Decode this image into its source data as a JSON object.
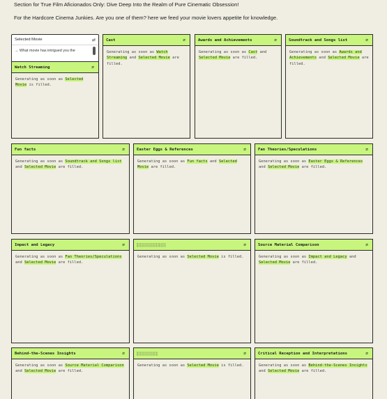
{
  "header": {
    "line1": "Section for True Film Aficionados Only: Dive Deep Into the Realm of Pure Cinematic Obsession!",
    "line2": "For the Hardcore Cinema Junkies. Are you one of them? here we feed your movie lovers appetite for knowledge."
  },
  "selected_movie": {
    "label": "Selected Movie",
    "prompt": "→ What movie has intrigued you the"
  },
  "common": {
    "prefix": "Generating as soon as ",
    "and": " and ",
    "is_filled": " is filled.",
    "are_filled": " are filled.",
    "selected_movie": "Selected Movie",
    "icon": "⇄"
  },
  "cards": {
    "watch_streaming": {
      "title": "Watch Streaming"
    },
    "cast": {
      "title": "Cast",
      "dep": "Watch Streaming"
    },
    "awards": {
      "title": "Awards and Achievements",
      "dep": "Cast"
    },
    "soundtrack": {
      "title": "Soundtrack and Songs list",
      "dep": "Awards and Achievements"
    },
    "fun_facts": {
      "title": "Fun facts",
      "dep": "Soundtrack and Songs list"
    },
    "easter_eggs": {
      "title": "Easter Eggs & References",
      "dep": "Fun facts"
    },
    "fan_theories": {
      "title": "Fan Theories/Speculations",
      "dep": "Easter Eggs & References"
    },
    "impact": {
      "title": "Impact and Legacy",
      "dep": "Fan Theories/Speculations"
    },
    "blank1": {
      "title": "░░░░░░░░░░░"
    },
    "source_material": {
      "title": "Source Material Comparison",
      "dep": "Impact and Legacy"
    },
    "behind_scenes": {
      "title": "Behind-the-Scenes Insights",
      "dep": "Source Material Comparison"
    },
    "blank2": {
      "title": "░░░░░░░░"
    },
    "critical": {
      "title": "Critical Reception and Interpretations",
      "dep": "Behind-the-Scenes Insights"
    }
  }
}
